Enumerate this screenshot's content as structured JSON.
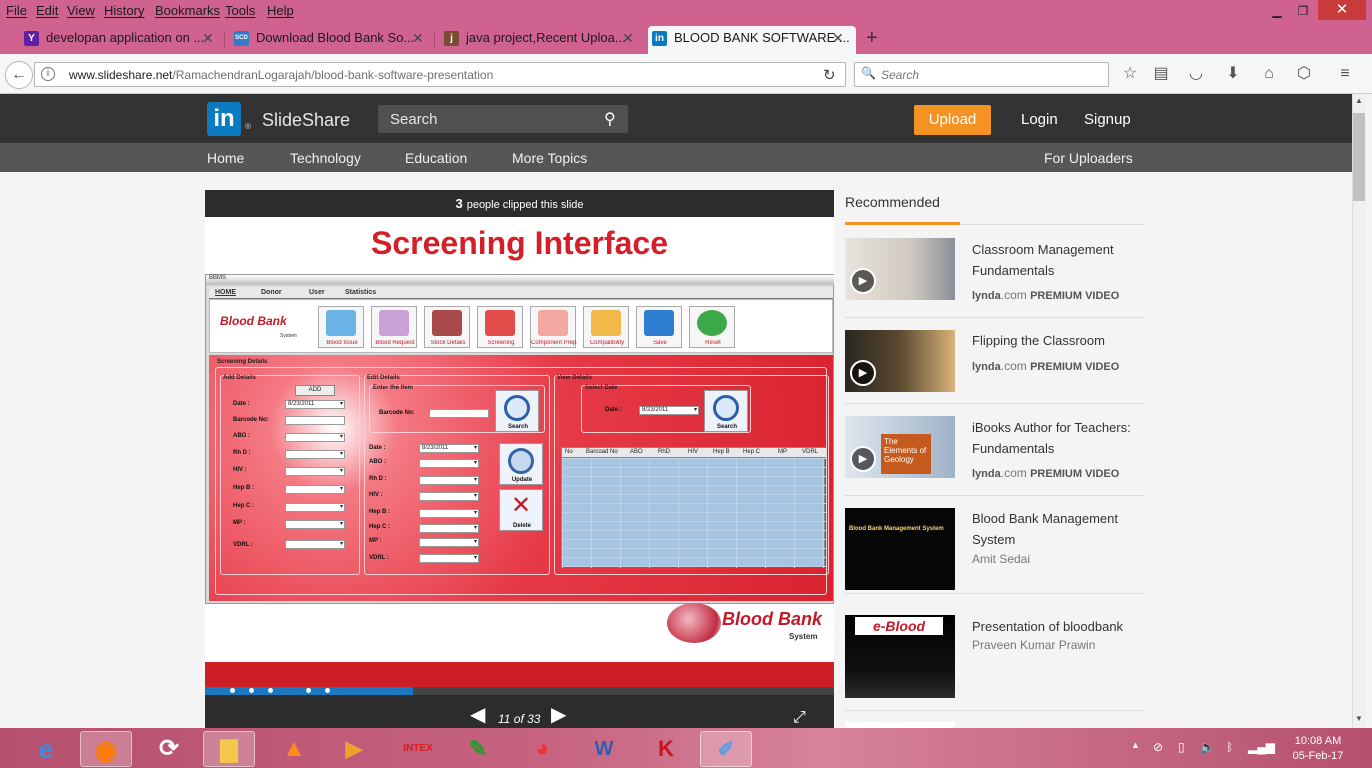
{
  "menu": [
    "File",
    "Edit",
    "View",
    "History",
    "Bookmarks",
    "Tools",
    "Help"
  ],
  "tabs": [
    {
      "title": "developan application on ...",
      "icon": "yahoo-icon",
      "color": "#5f1fa8",
      "glyph": "Y"
    },
    {
      "title": "Download Blood Bank So...",
      "icon": "scd-icon",
      "color": "#3a79c8",
      "glyph": "SCD"
    },
    {
      "title": "java project,Recent Uploa...",
      "icon": "java-icon",
      "color": "#7a4b33",
      "glyph": "j"
    },
    {
      "title": "BLOOD BANK SOFTWARE ...",
      "icon": "linkedin-icon",
      "color": "#0a7bc0",
      "glyph": "in"
    }
  ],
  "url": {
    "host": "www.slideshare.net",
    "path": "/RamachendranLogarajah/blood-bank-software-presentation"
  },
  "browser_search": {
    "placeholder": "Search"
  },
  "site": {
    "brand_glyph": "in",
    "brand_reg": "®",
    "name": "SlideShare",
    "search": "Search",
    "upload": "Upload",
    "login": "Login",
    "signup": "Signup"
  },
  "subnav": [
    "Home",
    "Technology",
    "Education",
    "More Topics"
  ],
  "for_uploaders": "For Uploaders",
  "slide": {
    "clipped_count": "3",
    "clipped_text": "people clipped this slide",
    "title": "Screening Interface",
    "app": {
      "window_title": "BBMS",
      "tabs": [
        "HOME",
        "Donor",
        "User",
        "Statistics"
      ],
      "logo": "Blood Bank",
      "logo_sub": "System",
      "toolbar": [
        "Blood Issue",
        "Blood Request",
        "Stock Details",
        "Screening",
        "Component Preparation",
        "Compatibility",
        "Save",
        "Reset"
      ],
      "panel_title": "Screening Details",
      "add_group": "Add Details",
      "add_button": "ADD",
      "add_fields": [
        "Date :",
        "Barcode No:",
        "ABO :",
        "Rh D :",
        "HIV :",
        "Hep B :",
        "Hep C :",
        "MP :",
        "VDRL :"
      ],
      "date_value": "8/23/2011",
      "edit_group": "Edit Details",
      "enter_item": "Enter the Item",
      "barcode_label": "Barcode No:",
      "search_label": "Search",
      "edit_fields": [
        "Date :",
        "ABO :",
        "Rh D :",
        "HIV :",
        "Hep B :",
        "Hep C :",
        "MP :",
        "VDRL :"
      ],
      "update_label": "Update",
      "delete_label": "Delete",
      "view_group": "View Details",
      "select_date": "Select Date",
      "view_date_label": "Date :",
      "table_headers": [
        "No",
        "Barcoad No",
        "ABO",
        "RhD",
        "HIV",
        "Hep B",
        "Hep C",
        "MP",
        "VDRL"
      ]
    },
    "footer_logo": "Blood Bank",
    "footer_sub": "System",
    "progress": 0.33,
    "page": "11 of 33"
  },
  "recommended_label": "Recommended",
  "recommended": [
    {
      "title": "Classroom Management Fundamentals",
      "source": "lynda",
      "source_suffix": ".com",
      "badge": "PREMIUM VIDEO",
      "video": true
    },
    {
      "title": "Flipping the Classroom",
      "source": "lynda",
      "source_suffix": ".com",
      "badge": "PREMIUM VIDEO",
      "video": true
    },
    {
      "title": "iBooks Author for Teachers: Fundamentals",
      "source": "lynda",
      "source_suffix": ".com",
      "badge": "PREMIUM VIDEO",
      "video": true,
      "thumb_text": "The Elements of Geology"
    },
    {
      "title": "Blood Bank Management System",
      "author": "Amit Sedai",
      "thumb_text": "Blood Bank Management System"
    },
    {
      "title": "Presentation of bloodbank",
      "author": "Praveen Kumar Prawin",
      "thumb_text": "e-Blood"
    }
  ],
  "taskbar": {
    "time": "10:08 AM",
    "date": "05-Feb-17",
    "intex": "INTEX"
  }
}
